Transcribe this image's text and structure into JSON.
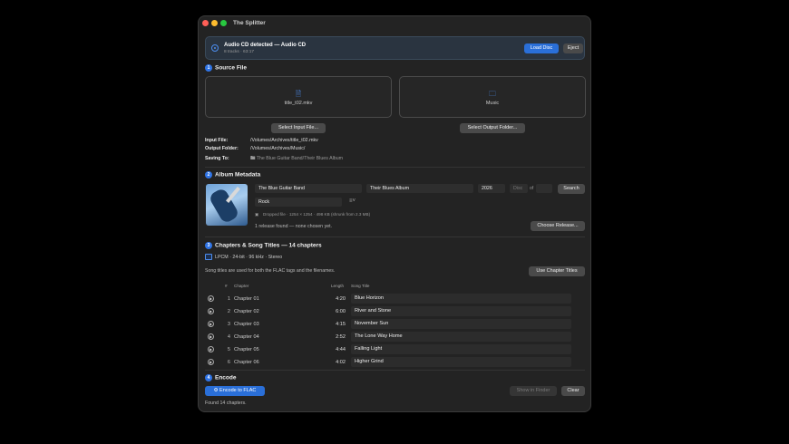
{
  "window": {
    "title": "The Splitter"
  },
  "banner": {
    "title": "Audio CD detected — Audio CD",
    "subtitle": "8 tracks · 63:17",
    "load_label": "Load Disc",
    "eject_label": "Eject",
    "accent": "#2a6fd8"
  },
  "source": {
    "number": "1",
    "heading": "Source File",
    "input_drop_label": "title_t02.mkv",
    "output_drop_label": "Music",
    "select_input_label": "Select Input File...",
    "select_output_label": "Select Output Folder...",
    "input_key": "Input File:",
    "input_value": "/Volumes/Archives/title_t02.mkv",
    "output_key": "Output Folder:",
    "output_value": "/Volumes/Archives/Music/",
    "saving_key": "Saving To:",
    "saving_value": "The Blue Guitar Band/Their Blues Album"
  },
  "metadata": {
    "number": "2",
    "heading": "Album Metadata",
    "artist": "The Blue Guitar Band",
    "album": "Their Blues Album",
    "year": "2026",
    "disc_placeholder": "Disc",
    "of_label": "of",
    "search_label": "Search",
    "genre": "Rock",
    "art_info": "Dropped file · 1254 × 1254 · 498 KB (shrunk from 2.3 MB)",
    "release_status": "1 release found — none chosen yet.",
    "choose_release_label": "Choose Release..."
  },
  "chapters": {
    "number": "3",
    "heading": "Chapters & Song Titles — 14 chapters",
    "format": "LPCM · 24-bit · 96 kHz · Stereo",
    "note": "Song titles are used for both the FLAC tags and the filenames.",
    "use_titles_label": "Use Chapter Titles",
    "columns": {
      "num": "#",
      "chapter": "Chapter",
      "length": "Length",
      "song": "Song Title"
    },
    "rows": [
      {
        "num": "1",
        "chapter": "Chapter 01",
        "length": "4:20",
        "song": "Blue Horizon"
      },
      {
        "num": "2",
        "chapter": "Chapter 02",
        "length": "6:00",
        "song": "River and Stone"
      },
      {
        "num": "3",
        "chapter": "Chapter 03",
        "length": "4:15",
        "song": "November Sun"
      },
      {
        "num": "4",
        "chapter": "Chapter 04",
        "length": "2:52",
        "song": "The Lone Way Home"
      },
      {
        "num": "5",
        "chapter": "Chapter 05",
        "length": "4:44",
        "song": "Falling Light"
      },
      {
        "num": "6",
        "chapter": "Chapter 06",
        "length": "4:02",
        "song": "Higher Grind"
      }
    ]
  },
  "encode": {
    "number": "4",
    "heading": "Encode",
    "encode_label": "Encode to FLAC",
    "show_finder_label": "Show in Finder",
    "clear_label": "Clear",
    "status": "Found 14 chapters."
  }
}
